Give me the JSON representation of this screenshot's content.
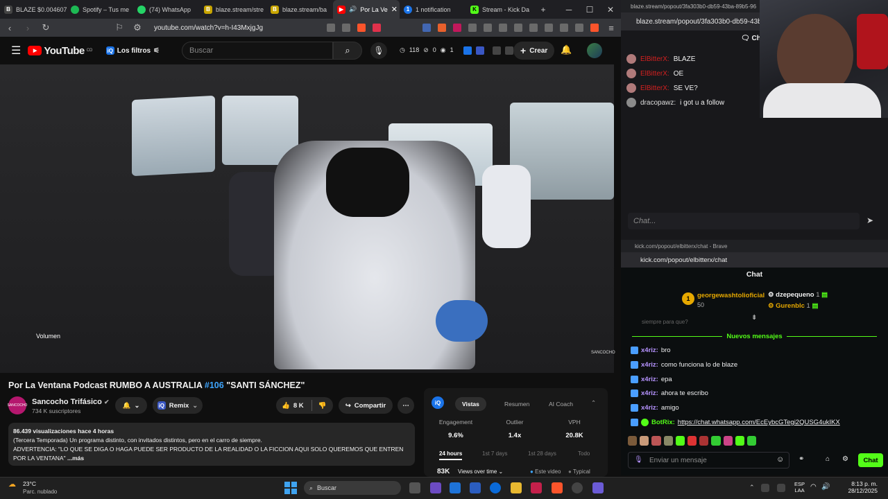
{
  "browser": {
    "tabs": [
      {
        "label": "BLAZE $0.004607",
        "color": "#333"
      },
      {
        "label": "Spotify – Tus me",
        "color": "#1db954"
      },
      {
        "label": "(74) WhatsApp",
        "color": "#25d366"
      },
      {
        "label": "blaze.stream/stre",
        "color": "#c8a500"
      },
      {
        "label": "blaze.stream/ba",
        "color": "#c8a500"
      },
      {
        "label": "Por La Ve",
        "color": "#ff0000"
      },
      {
        "label": "1 notification",
        "color": "#1a73e8"
      },
      {
        "label": "Stream - Kick Da",
        "color": "#53fc18"
      }
    ],
    "url": "youtube.com/watch?v=h-I43MxjgJg"
  },
  "youtube": {
    "logo_text": "YouTube",
    "country": "CO",
    "filters_label": "Los filtros",
    "search_placeholder": "Buscar",
    "stats": {
      "likes": "118",
      "dislikes": "0",
      "views": "1"
    },
    "create_label": "Crear"
  },
  "video": {
    "volume_tooltip": "Volumen",
    "title_prefix": "Por La Ventana Podcast RUMBO A AUSTRALIA ",
    "title_tag": "#106",
    "title_suffix": " \"SANTI SÁNCHEZ\"",
    "channel_name": "Sancocho Trifásico",
    "channel_avatar_text": "SANCOCHO",
    "subscribers": "734 K suscriptores",
    "remix_label": "Remix",
    "likes": "8 K",
    "share_label": "Compartir",
    "description": {
      "views_time": "86.439 visualizaciones  hace 4 horas",
      "line1": "(Tercera Temporada) Un programa distinto, con invitados distintos, pero en el carro de siempre.",
      "line2": "ADVERTENCIA: \"LO QUE SE DIGA O HAGA PUEDE SER PRODUCTO DE LA REALIDAD O LA FICCION AQUI SOLO QUEREMOS QUE ENTREN",
      "line3": "POR LA VENTANA\"",
      "more": "...más"
    }
  },
  "analytics": {
    "tabs": [
      "Vistas",
      "Resumen",
      "AI Coach"
    ],
    "metrics": [
      {
        "label": "Engagement",
        "value": "9.6%"
      },
      {
        "label": "Outlier",
        "value": "1.4x"
      },
      {
        "label": "VPH",
        "value": "20.8K"
      }
    ],
    "ranges": [
      "24 hours",
      "1st 7 days",
      "1st 28 days",
      "Todo"
    ],
    "views_count": "83K",
    "views_over_time": "Views over time",
    "legend_this": "Este video",
    "legend_typical": "Typical"
  },
  "blaze": {
    "window_title": "blaze.stream/popout/3fa303b0-db59-43ba-89b5-96",
    "url": "blaze.stream/popout/3fa303b0-db59-43ba",
    "chat_header": "Ch",
    "messages": [
      {
        "user": "ElBitterX:",
        "text": "BLAZE"
      },
      {
        "user": "ElBitterX:",
        "text": "OE"
      },
      {
        "user": "ElBitterX:",
        "text": "SE VE?"
      },
      {
        "user": "dracopawz:",
        "text": "i got u a follow"
      }
    ],
    "input_placeholder": "Chat..."
  },
  "kick": {
    "window_title": "kick.com/popout/elbitterx/chat - Brave",
    "url": "kick.com/popout/elbitterx/chat",
    "chat_header": "Chat",
    "gifters": [
      {
        "name": "georgewashtolioficial",
        "count": "50"
      },
      {
        "name": "dzepequeno",
        "count": "1"
      },
      {
        "name": "Gurenblc",
        "count": "1"
      }
    ],
    "partial_message": "siempre para que?",
    "new_messages_label": "Nuevos mensajes",
    "messages": [
      {
        "user": "x4riz:",
        "text": "bro"
      },
      {
        "user": "x4riz:",
        "text": "como funciona lo de blaze"
      },
      {
        "user": "x4riz:",
        "text": "epa"
      },
      {
        "user": "x4riz:",
        "text": "ahora te escribo"
      },
      {
        "user": "x4riz:",
        "text": "amigo"
      }
    ],
    "bot_user": "BotRix:",
    "bot_link": "https://chat.whatsapp.com/EcEybcGTegi2QUSG4ukIKX",
    "input_placeholder": "Enviar un mensaje",
    "send_label": "Chat"
  },
  "taskbar": {
    "weather_temp": "23°C",
    "weather_desc": "Parc. nublado",
    "search_label": "Buscar",
    "lang": "ESP",
    "lang2": "LAA",
    "time": "8:13 p. m.",
    "date": "28/12/2025"
  }
}
